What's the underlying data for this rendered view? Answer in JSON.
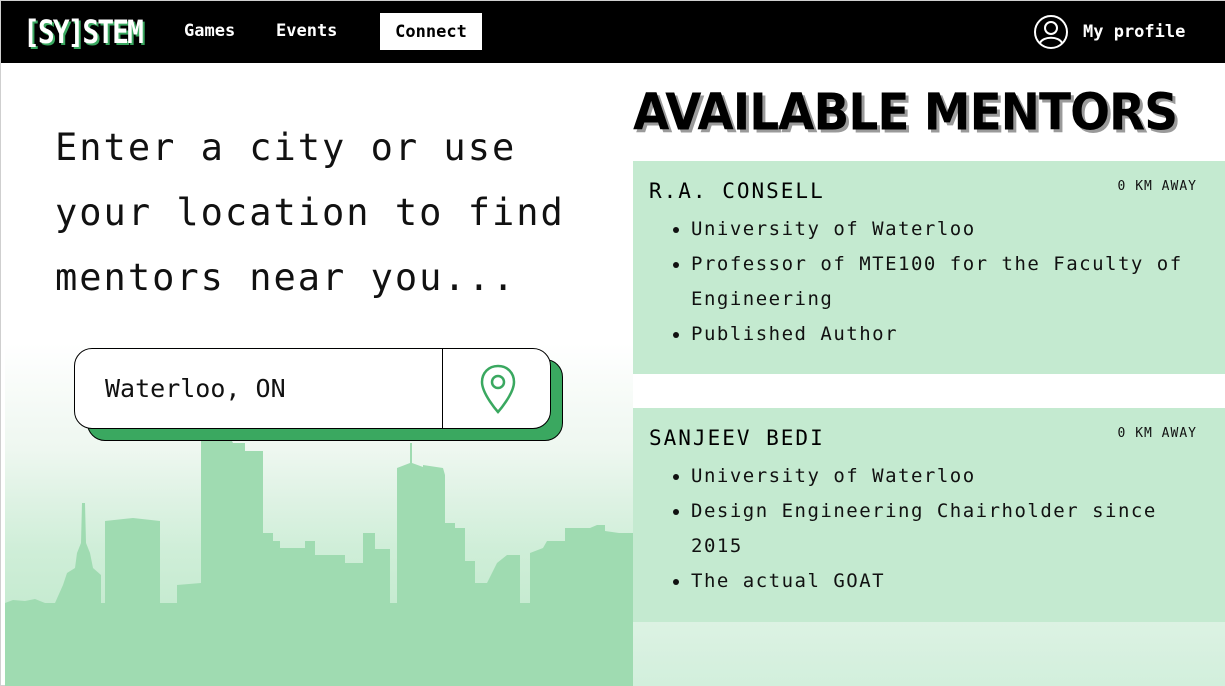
{
  "brand": {
    "logo_text": "[SY]STEM"
  },
  "nav": {
    "links": [
      "Games",
      "Events"
    ],
    "active_link": "Connect",
    "profile_label": "My profile"
  },
  "search": {
    "prompt": "Enter a city or use your location to find mentors near you...",
    "value": "Waterloo, ON"
  },
  "mentors": {
    "title": "AVAILABLE MENTORS",
    "items": [
      {
        "name": "R.A. CONSELL",
        "distance": "0 KM AWAY",
        "details": [
          "University of Waterloo",
          "Professor of MTE100 for the Faculty of Engineering",
          "Published Author"
        ]
      },
      {
        "name": "SANJEEV BEDI",
        "distance": "0 KM AWAY",
        "details": [
          "University of Waterloo",
          "Design Engineering Chairholder since 2015",
          "The actual GOAT"
        ]
      }
    ]
  },
  "colors": {
    "accent_green": "#3aa860",
    "card_green": "#c4ead0",
    "skyline_green": "#9fdbb1",
    "nav_bg": "#000000"
  },
  "icons": {
    "profile": "user-circle-icon",
    "location": "map-pin-icon"
  }
}
